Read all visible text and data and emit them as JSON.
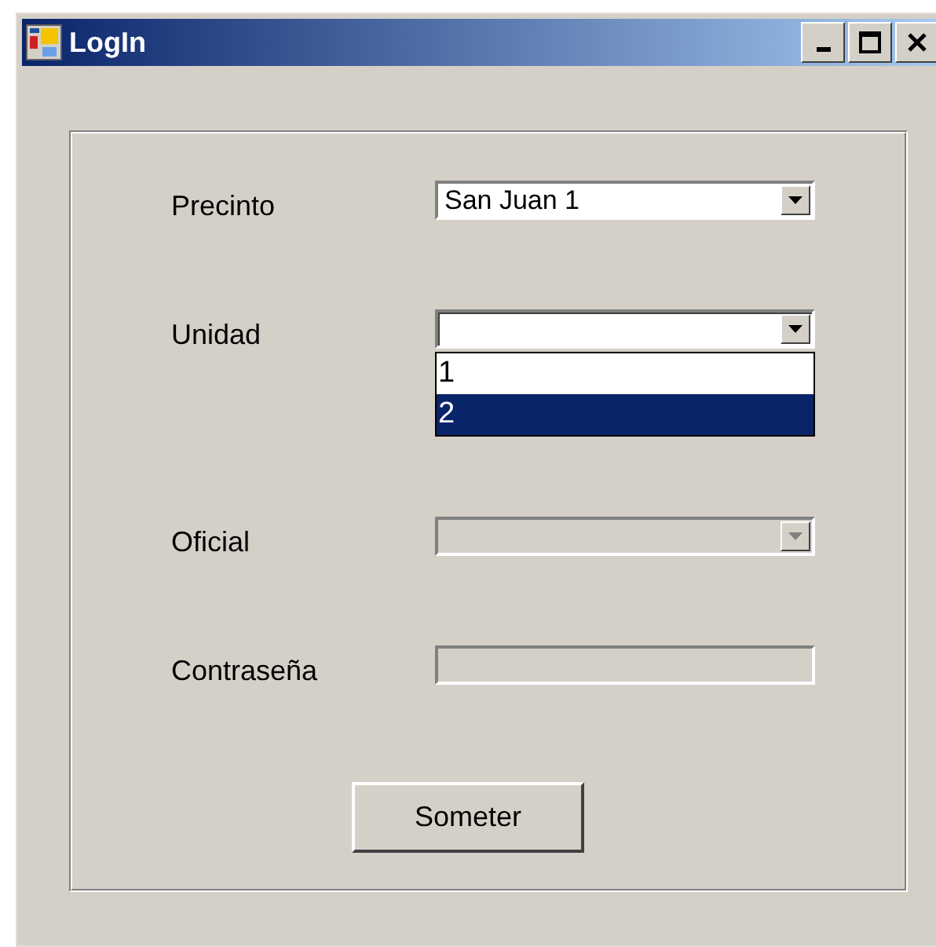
{
  "window": {
    "title": "LogIn"
  },
  "fields": [
    {
      "kind": "combo",
      "label": "Precinto",
      "value": "San Juan 1",
      "disabled": false,
      "expanded": false
    },
    {
      "kind": "combo",
      "label": "Unidad",
      "disabled": false,
      "expanded": true,
      "options": [
        {
          "label": "1",
          "selected": false
        },
        {
          "label": "2",
          "selected": true
        }
      ]
    },
    {
      "kind": "combo",
      "label": "Oficial",
      "disabled": true,
      "expanded": false
    },
    {
      "kind": "text",
      "label": "Contraseña",
      "disabled": true
    }
  ],
  "submit": {
    "label": "Someter"
  }
}
